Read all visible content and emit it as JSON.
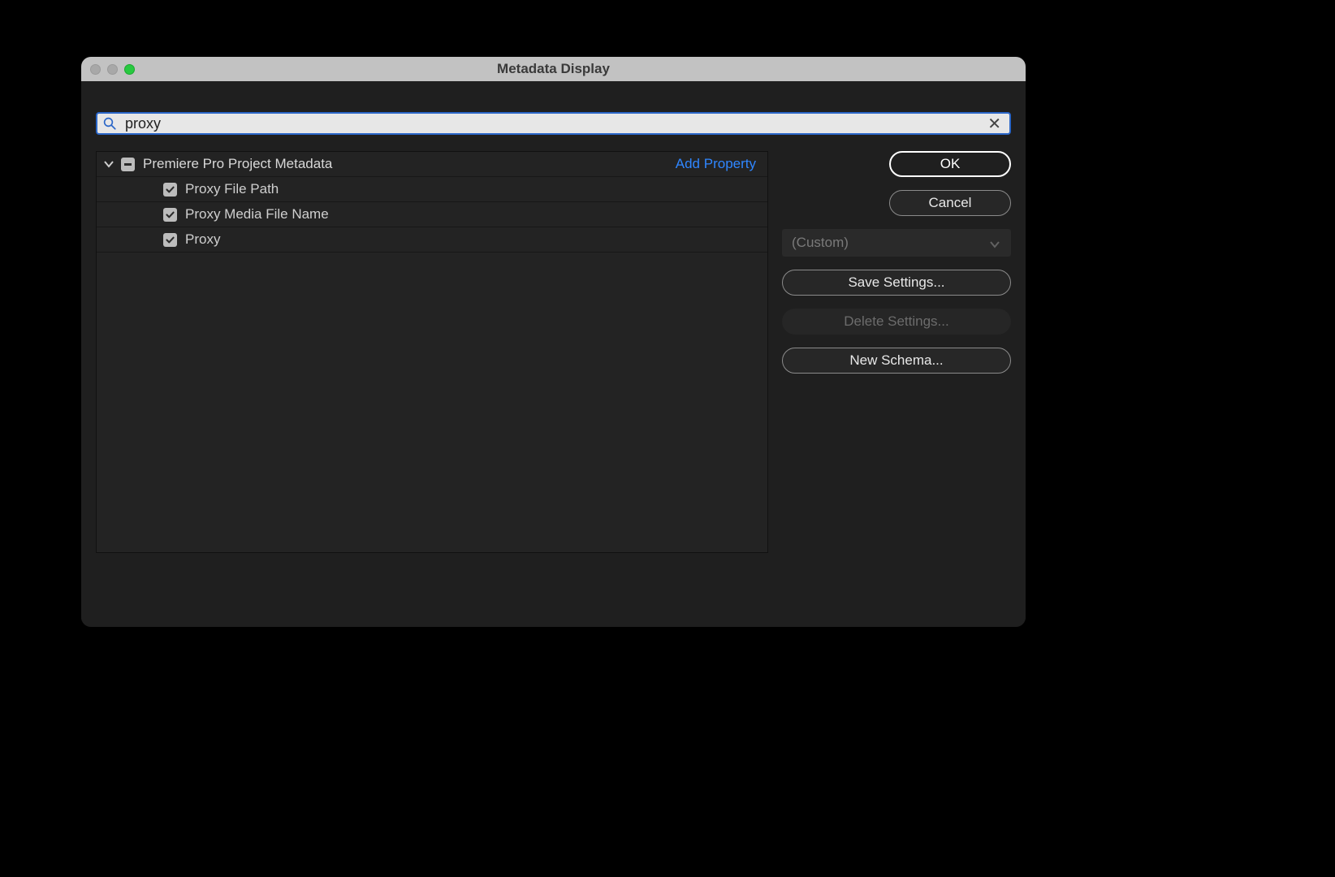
{
  "window": {
    "title": "Metadata Display"
  },
  "search": {
    "value": "proxy"
  },
  "tree": {
    "group_label": "Premiere Pro Project Metadata",
    "add_property_label": "Add Property",
    "items": [
      {
        "label": "Proxy File Path"
      },
      {
        "label": "Proxy Media File Name"
      },
      {
        "label": "Proxy"
      }
    ]
  },
  "side": {
    "ok": "OK",
    "cancel": "Cancel",
    "preset_selected": "(Custom)",
    "save_settings": "Save Settings...",
    "delete_settings": "Delete Settings...",
    "new_schema": "New Schema..."
  }
}
